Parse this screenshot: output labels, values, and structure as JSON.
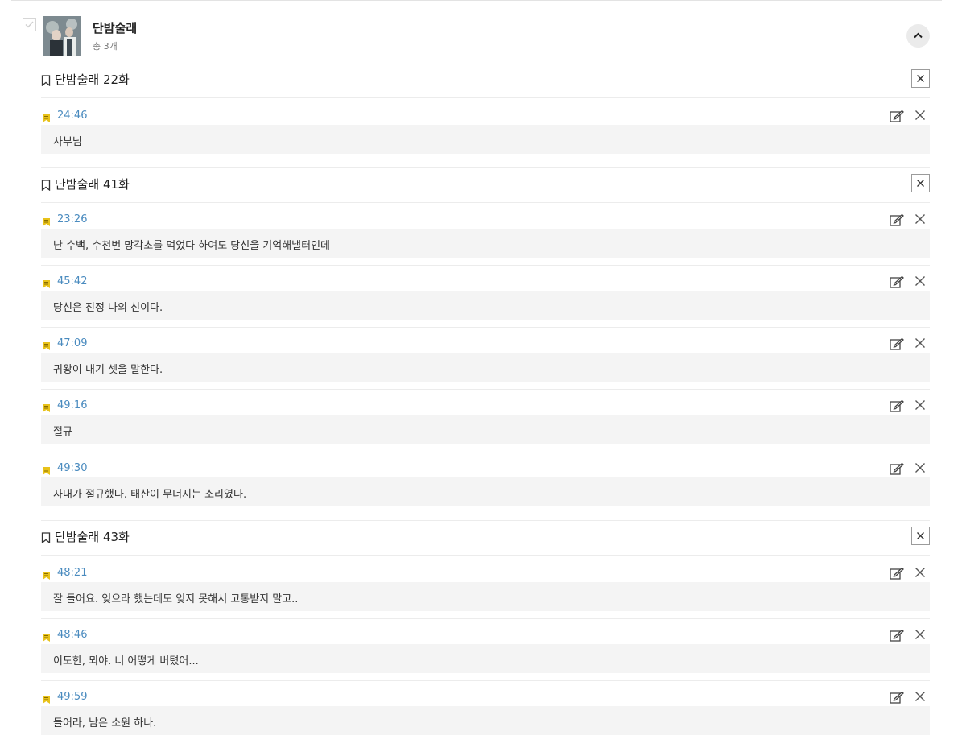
{
  "series": {
    "title": "단밤술래",
    "count": "총 3개"
  },
  "episodes": [
    {
      "title": "단밤술래 22화",
      "marks": [
        {
          "time": "24:46",
          "text": "사부님"
        }
      ]
    },
    {
      "title": "단밤술래 41화",
      "marks": [
        {
          "time": "23:26",
          "text": "난 수백, 수천번 망각초를 먹었다 하여도 당신을 기억해낼터인데"
        },
        {
          "time": "45:42",
          "text": "당신은 진정 나의 신이다."
        },
        {
          "time": "47:09",
          "text": "귀왕이 내기 셋을 말한다."
        },
        {
          "time": "49:16",
          "text": "절규"
        },
        {
          "time": "49:30",
          "text": "사내가 절규했다. 태산이 무너지는 소리였다."
        }
      ]
    },
    {
      "title": "단밤술래 43화",
      "marks": [
        {
          "time": "48:21",
          "text": "잘 들어요. 잊으라 했는데도 잊지 못해서 고통받지 말고.."
        },
        {
          "time": "48:46",
          "text": "이도한, 뫼야. 너 어떻게 버텼어..."
        },
        {
          "time": "49:59",
          "text": "들어라, 남은 소원 하나."
        }
      ]
    }
  ],
  "colors": {
    "time": "#4a8bbf",
    "flag": "#e8c21a",
    "box": "#f4f4f4"
  },
  "icons": {
    "check": "checkmark-icon",
    "collapse": "chevron-up-icon",
    "bookmark": "bookmark-outline-icon",
    "flag": "bookmark-flag-icon",
    "edit": "edit-icon",
    "delete": "close-icon"
  }
}
